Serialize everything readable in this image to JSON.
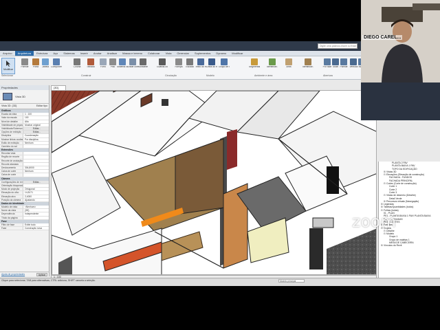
{
  "app": {
    "search_placeholder": "Digite uma palavra-chave ou frase"
  },
  "ribbon": {
    "tabs": [
      "Arquivo",
      "Arquitetura",
      "Estrutura",
      "Aço",
      "Sistemas",
      "Inserir",
      "Anotar",
      "Analisar",
      "Massa e terreno",
      "Colaborar",
      "Vista",
      "Gerenciar",
      "Suplementos",
      "Dynamo",
      "Modificar"
    ],
    "active_tab": "Arquitetura",
    "select_label": "Modificar",
    "buttons": [
      {
        "label": "Parede",
        "color": "#8a8a8a"
      },
      {
        "label": "Porta",
        "color": "#b47a3c"
      },
      {
        "label": "Janela",
        "color": "#6ea0d0"
      },
      {
        "label": "Componente",
        "color": "#5a7fb0"
      },
      {
        "label": "Coluna",
        "color": "#777777"
      },
      {
        "label": "Telhado",
        "color": "#b05a3a"
      },
      {
        "label": "Forro",
        "color": "#9aa7b8"
      },
      {
        "label": "Piso",
        "color": "#8c8c8c"
      },
      {
        "label": "Sistema cortina",
        "color": "#5f86b8"
      },
      {
        "label": "Grade cortina",
        "color": "#7b8fa8"
      },
      {
        "label": "Montante",
        "color": "#6a6a6a"
      },
      {
        "label": "Guarda-corpo",
        "color": "#5a5a5a"
      },
      {
        "label": "Rampa",
        "color": "#8a8a8a"
      },
      {
        "label": "Escada",
        "color": "#7a7a7a"
      },
      {
        "label": "Texto do modelo",
        "color": "#4a6a9a"
      },
      {
        "label": "Linha do modelo",
        "color": "#3a5a8a"
      },
      {
        "label": "Grupo de modelos",
        "color": "#4f75a8"
      },
      {
        "label": "Segmentar ambiente",
        "color": "#c89a3a"
      },
      {
        "label": "Identificar ambiente",
        "color": "#6a9a4a"
      },
      {
        "label": "Área",
        "color": "#c0a070"
      },
      {
        "label": "Identificar área",
        "color": "#a08050"
      },
      {
        "label": "Por face",
        "color": "#5a7aa0"
      },
      {
        "label": "Shaft",
        "color": "#4a6a90"
      },
      {
        "label": "Parede",
        "color": "#5a7aa0"
      },
      {
        "label": "Vertical",
        "color": "#4a6a90"
      },
      {
        "label": "Trapeira",
        "color": "#5a7aa0"
      }
    ],
    "panels": [
      "Selecionar",
      "Construir",
      "Circulação",
      "Modelo",
      "Ambiente e área",
      "Abertura"
    ]
  },
  "properties": {
    "title": "Propriedades",
    "type_name": "Vista 3D",
    "type_bar_left": "Vista 3D: {3D}",
    "edit_type_label": "Editar tipo",
    "sections": [
      {
        "name": "Gráficos",
        "rows": [
          {
            "k": "Escala da vista",
            "v": "1 : 100"
          },
          {
            "k": "Valor da escala",
            "v": "100"
          },
          {
            "k": "Nível de detalhe",
            "v": "Alto"
          },
          {
            "k": "Visibilidade de peças",
            "v": "Mostrar original"
          },
          {
            "k": "Visibilidade/Sobrescr.",
            "v": "Editar...",
            "btn": true
          },
          {
            "k": "Opções de exibição",
            "v": "Editar...",
            "btn": true
          },
          {
            "k": "Disciplina",
            "v": "Coordenação"
          },
          {
            "k": "Mostrar linhas ocultas",
            "v": "Por disciplina"
          },
          {
            "k": "Estilo de exibição",
            "v": "Nenhum"
          },
          {
            "k": "Caminho do sol",
            "v": ""
          }
        ]
      },
      {
        "name": "Extensões",
        "rows": [
          {
            "k": "Recortar vista",
            "v": ""
          },
          {
            "k": "Região de recorte",
            "v": ""
          },
          {
            "k": "Recorte de anotação",
            "v": ""
          },
          {
            "k": "Recorte afastado",
            "v": ""
          },
          {
            "k": "Deslocamento",
            "v": "304,8000"
          },
          {
            "k": "Caixa de corte",
            "v": "Nenhum"
          },
          {
            "k": "Caixa de corte",
            "v": ""
          }
        ]
      },
      {
        "name": "Câmera",
        "rows": [
          {
            "k": "Configurações de renderização",
            "v": "Editar...",
            "btn": true
          },
          {
            "k": "Orientação bloqueada",
            "v": ""
          },
          {
            "k": "Modo de projeção",
            "v": "Ortogonal"
          },
          {
            "k": "Elevação do olho",
            "v": "14,8171"
          },
          {
            "k": "Elevação alvo",
            "v": "2,4000"
          },
          {
            "k": "Posição da câmera",
            "v": "Ajustando"
          }
        ]
      },
      {
        "name": "Dados de identidade",
        "rows": [
          {
            "k": "Modelo de vista",
            "v": "<Nenhum>"
          },
          {
            "k": "Nome da vista",
            "v": "{3D}"
          },
          {
            "k": "Dependência",
            "v": "Independente"
          },
          {
            "k": "Título da página",
            "v": ""
          }
        ]
      },
      {
        "name": "Fase",
        "rows": [
          {
            "k": "Filtro de fase",
            "v": "Exibir tudo"
          },
          {
            "k": "Fase",
            "v": "Construção nova"
          }
        ]
      }
    ],
    "help_link": "Ajuda de propriedades",
    "apply_label": "Aplicar"
  },
  "view": {
    "tab_label": "{3D}",
    "scale": "1 : 100"
  },
  "browser": {
    "items": [
      {
        "indent": 4,
        "label": "PLANTA 2 PAV"
      },
      {
        "indent": 4,
        "label": "PLANTA BAIXA 1 PAV"
      },
      {
        "indent": 4,
        "label": "TOPO DA EDIFICAÇÃO"
      },
      {
        "indent": 1,
        "toggle": "⊞",
        "label": "Vistas 3D"
      },
      {
        "indent": 1,
        "toggle": "⊟",
        "label": "Elevações (Elevação de construção)"
      },
      {
        "indent": 3,
        "label": "FACHADA - FUNDOS"
      },
      {
        "indent": 3,
        "label": "FACHADA PRINCIPAL"
      },
      {
        "indent": 1,
        "toggle": "⊟",
        "label": "Cortes (Corte de construção)"
      },
      {
        "indent": 3,
        "label": "Corte 1"
      },
      {
        "indent": 3,
        "label": "Corte 2"
      },
      {
        "indent": 3,
        "label": "Corte 3"
      },
      {
        "indent": 1,
        "toggle": "⊟",
        "label": "Vistas de desenho (Detalhe)"
      },
      {
        "indent": 3,
        "label": "Detail Verde"
      },
      {
        "indent": 1,
        "toggle": "⊞",
        "label": "Percursos virtuais (Navegação)"
      },
      {
        "indent": 0,
        "toggle": "⊞",
        "label": "Legendas"
      },
      {
        "indent": 0,
        "toggle": "⊞",
        "label": "Tabelas/Quantidades (todos)"
      },
      {
        "indent": 0,
        "toggle": "⊟",
        "label": "Folhas (todas)"
      },
      {
        "indent": 1,
        "label": "01 - PLAN"
      },
      {
        "indent": 1,
        "label": "PE1 - PLANTA BAIXA 1 PAV/ PLANTA BAIXA"
      },
      {
        "indent": 1,
        "label": "PE2 - FACHADAS"
      },
      {
        "indent": 1,
        "label": "PE3 - CORTES"
      },
      {
        "indent": 0,
        "toggle": "⊞",
        "label": "Famílias"
      },
      {
        "indent": 0,
        "toggle": "⊟",
        "label": "Grupos"
      },
      {
        "indent": 1,
        "toggle": "⊟",
        "label": "Detalhe"
      },
      {
        "indent": 1,
        "toggle": "⊟",
        "label": "Modelo"
      },
      {
        "indent": 3,
        "label": "Grupo 1"
      },
      {
        "indent": 3,
        "label": "Grupo de maletas 1"
      },
      {
        "indent": 3,
        "label": "MESA DE CABECEIRA"
      },
      {
        "indent": 0,
        "toggle": "⊞",
        "label": "Vínculos do Revit"
      }
    ]
  },
  "status": {
    "message": "Clique para selecionar, TAB para alternativas, CTRL adiciona, SHIFT cancela a seleção.",
    "model_label": "Modelo principal"
  },
  "webcam": {
    "participant_name": "DIEGO CAREL..."
  },
  "zoom": {
    "watermark": "zoom"
  }
}
